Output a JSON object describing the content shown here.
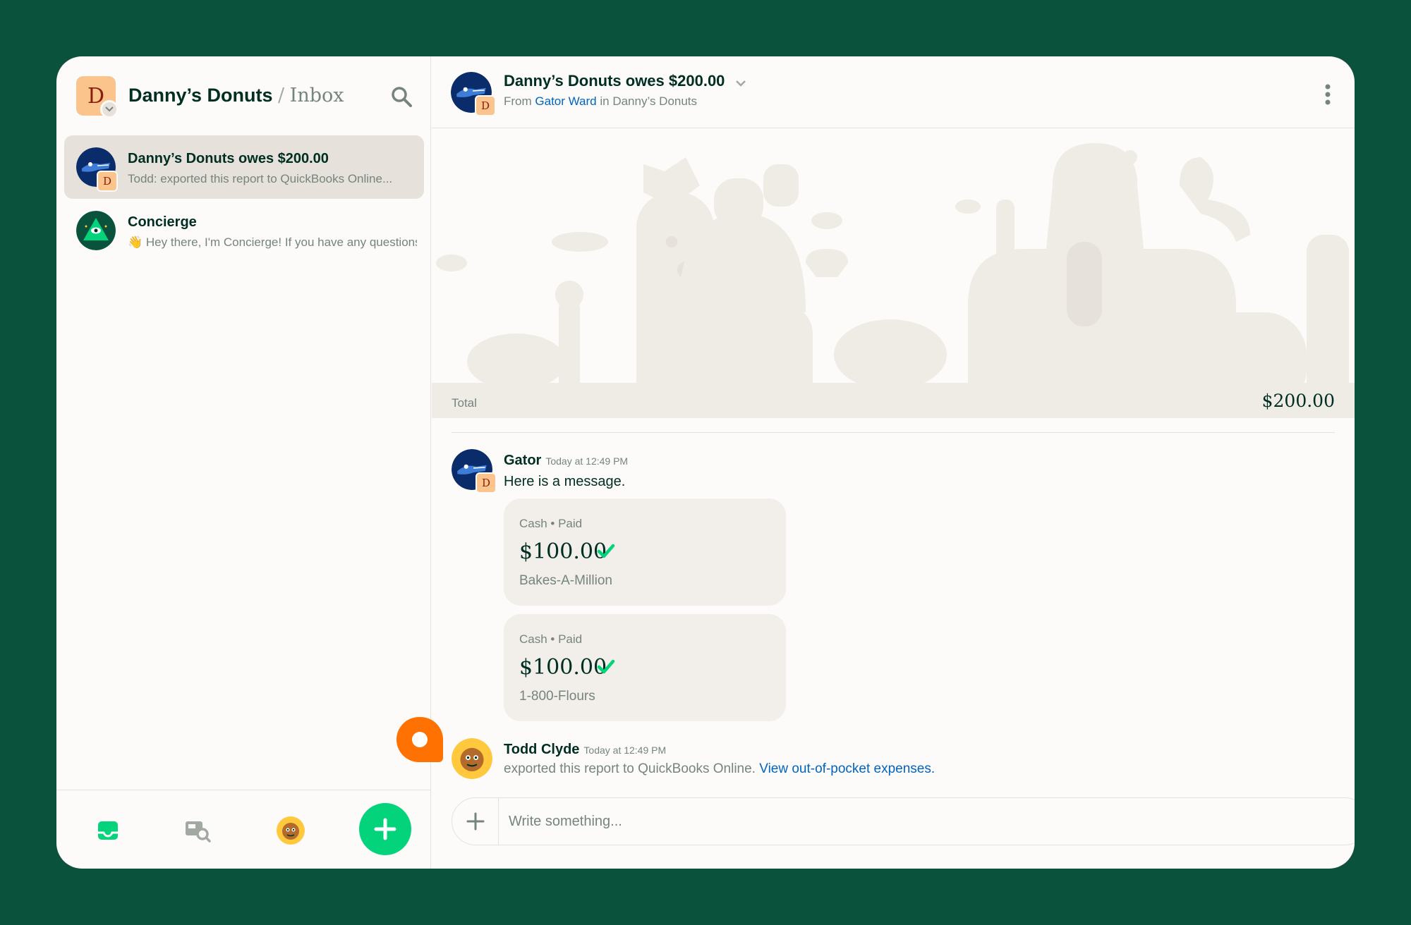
{
  "lhn": {
    "workspace_initial": "D",
    "workspace_name": "Danny’s Donuts",
    "separator": "/",
    "page_name": "Inbox",
    "chats": [
      {
        "name": "Danny’s Donuts owes $200.00",
        "preview": "Todd: exported this report to QuickBooks Online...",
        "sub_avatar_initial": "D"
      },
      {
        "name": "Concierge",
        "preview": "👋 Hey there, I'm Concierge! If you have any questions...",
        "sub_avatar_initial": ""
      }
    ]
  },
  "report": {
    "title": "Danny’s Donuts owes $200.00",
    "sub_from": "From",
    "sub_user": "Gator Ward",
    "sub_in": "in Danny’s Donuts",
    "avatar_initial": "D",
    "total_label": "Total",
    "total_value": "$200.00",
    "messages": [
      {
        "author": "Gator",
        "time": "Today at 12:49 PM",
        "text": "Here is a message.",
        "avatar_initial": "D",
        "cards": [
          {
            "meta": "Cash • Paid",
            "amount": "$100.00",
            "merchant": "Bakes-A-Million"
          },
          {
            "meta": "Cash • Paid",
            "amount": "$100.00",
            "merchant": "1-800-Flours"
          }
        ]
      },
      {
        "author": "Todd Clyde",
        "time": "Today at 12:49 PM",
        "text": "exported this report to QuickBooks Online.",
        "link": "View out-of-pocket expenses."
      }
    ],
    "composer_placeholder": "Write something..."
  },
  "colors": {
    "background": "#0a523b",
    "accent_green": "#03d47c",
    "link_blue": "#0164bf",
    "orange": "#ff7101"
  }
}
